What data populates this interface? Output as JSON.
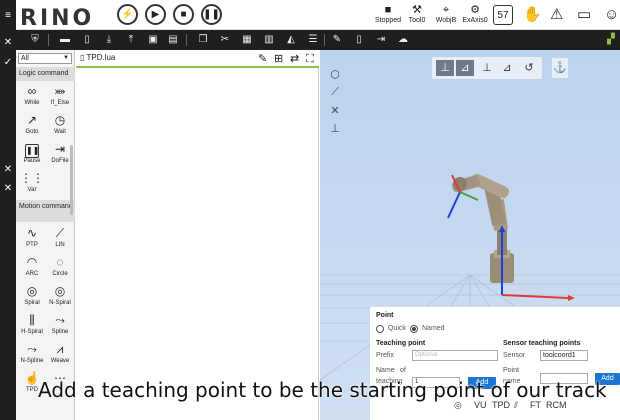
{
  "app": {
    "logo_text": "RINO"
  },
  "top_controls": [
    "Enable",
    "Run",
    "Stop",
    "Pause"
  ],
  "status": {
    "stopped": "Stopped",
    "tool": "Tool0",
    "wobj": "WobjB",
    "exaxis": "ExAxis0",
    "speed_value": "57"
  },
  "palette": {
    "filter": "All",
    "logic_heading": "Logic command",
    "logic_items": [
      "While",
      "If_Else",
      "Goto",
      "Wait",
      "Pause",
      "DoFile",
      "Var"
    ],
    "motion_heading": "Motion command",
    "motion_items": [
      "PTP",
      "LIN",
      "ARC",
      "Circle",
      "Spiral",
      "N-Spiral",
      "H-Spiral",
      "Spline",
      "N-Spline",
      "Weave",
      "TPD"
    ]
  },
  "editor": {
    "file_name": "TPD.lua"
  },
  "point_panel": {
    "title": "Point",
    "mode_quick": "Quick",
    "mode_named": "Named",
    "teaching_heading": "Teaching point",
    "prefix_label": "Prefix",
    "prefix_placeholder": "Optional",
    "name_label_1": "Name",
    "name_label_2": "of",
    "name_label_3": "teaching",
    "name_value": "1",
    "add_label": "Add",
    "sensor_heading": "Sensor teaching points",
    "sensor_label": "Sensor",
    "sensor_value": "toolcoord1",
    "point_label_1": "Point",
    "point_label_2": "name",
    "add2_label": "Add"
  },
  "bottom_toolbar": [
    "VU",
    "TPD",
    "FT",
    "RCM"
  ],
  "caption": "Add a teaching point to be the starting point of our track",
  "colors": {
    "x_axis": "#e53935",
    "y_axis": "#43a047",
    "z_axis": "#1e40d8",
    "accent_green": "#8bc34a",
    "button_blue": "#1976d2"
  }
}
